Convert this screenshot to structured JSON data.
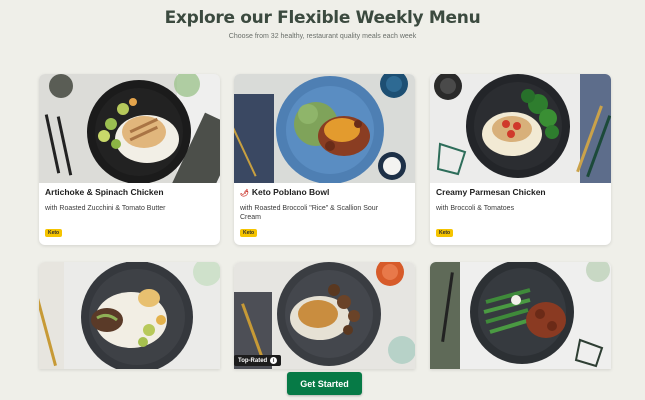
{
  "header": {
    "title": "Explore our Flexible Weekly Menu",
    "subtitle": "Choose from 32 healthy, restaurant quality meals each week"
  },
  "meals": [
    {
      "name": "Artichoke & Spinach Chicken",
      "description": "with Roasted Zucchini & Tomato Butter",
      "badge": "Keto",
      "spicy": false,
      "photo": "artichoke-spinach-chicken-photo"
    },
    {
      "name": "Keto Poblano Bowl",
      "description": "with Roasted Broccoli \"Rice\" & Scallion Sour Cream",
      "badge": "Keto",
      "spicy": true,
      "photo": "keto-poblano-bowl-photo"
    },
    {
      "name": "Creamy Parmesan Chicken",
      "description": "with Broccoli & Tomatoes",
      "badge": "Keto",
      "spicy": false,
      "photo": "creamy-parmesan-chicken-photo"
    },
    {
      "photo": "steak-cauliflower-rice-photo"
    },
    {
      "photo": "mushroom-chicken-photo",
      "chip": "Top-Rated"
    },
    {
      "photo": "green-beans-meatballs-photo"
    }
  ],
  "cta": {
    "label": "Get Started"
  },
  "colors": {
    "accent_green": "#067a46",
    "badge_yellow": "#f5c400",
    "background": "#efefe9"
  }
}
